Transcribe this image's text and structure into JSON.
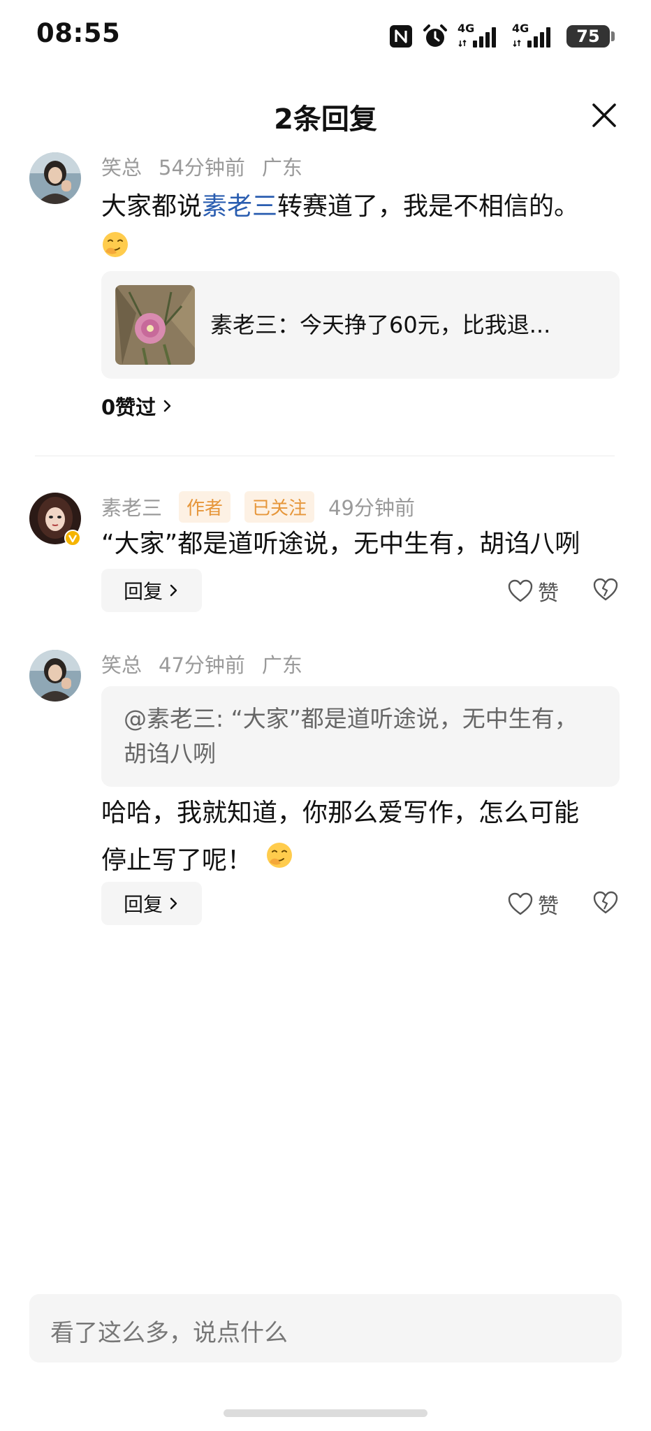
{
  "status_bar": {
    "time": "08:55",
    "signal1_label": "4G",
    "signal2_label": "4G",
    "battery": "75",
    "icons": [
      "nfc-icon",
      "alarm-icon",
      "signal-icon",
      "signal-icon",
      "battery-icon"
    ]
  },
  "header": {
    "title": "2条回复",
    "close_icon": "close-icon"
  },
  "comments": [
    {
      "author": "笑总",
      "time": "54分钟前",
      "location": "广东",
      "text_before": "大家都说",
      "mention": "素老三",
      "text_after": "转赛道了，我是不相信的。",
      "emoji": "face-with-hand-over-mouth",
      "quote_card": {
        "text": "素老三：今天挣了60元，比我退..."
      },
      "likes_text": "0赞过"
    },
    {
      "author": "素老三",
      "tag_author": "作者",
      "tag_follow": "已关注",
      "time": "49分钟前",
      "text": "“大家”都是道听途说，无中生有，胡诌八咧",
      "reply_label": "回复",
      "like_label": "赞"
    },
    {
      "author": "笑总",
      "time": "47分钟前",
      "location": "广东",
      "quoted": "@素老三: “大家”都是道听途说，无中生有，胡诌八咧",
      "line1": "哈哈，我就知道，你那么爱写作，怎么可能",
      "line2": "停止写了呢！",
      "emoji": "face-with-hand-over-mouth",
      "reply_label": "回复",
      "like_label": "赞"
    }
  ],
  "input": {
    "placeholder": "看了这么多，说点什么"
  },
  "colors": {
    "mention": "#2a5db0",
    "tag_text": "#e6963a",
    "tag_bg": "#fdf1e4",
    "meta": "#9a9a9a",
    "card_bg": "#f5f5f5"
  }
}
